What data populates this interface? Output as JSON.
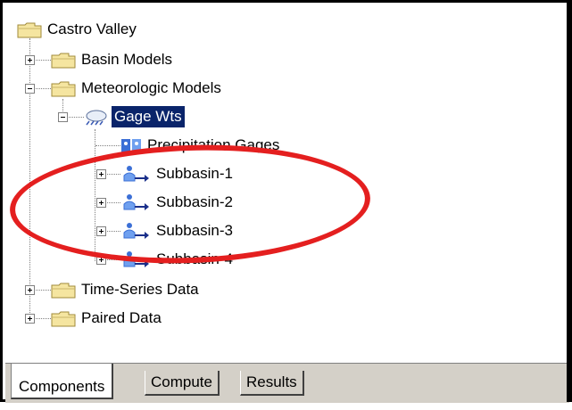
{
  "tree": {
    "root": "Castro Valley",
    "basin_models": "Basin Models",
    "meteorologic_models": "Meteorologic Models",
    "gage_wts": "Gage Wts",
    "precipitation_gages": "Precipitation Gages",
    "subbasins": [
      "Subbasin-1",
      "Subbasin-2",
      "Subbasin-3",
      "Subbasin-4"
    ],
    "time_series_data": "Time-Series Data",
    "paired_data": "Paired Data"
  },
  "tabs": {
    "components": "Components",
    "compute": "Compute",
    "results": "Results"
  },
  "icons": {
    "folder": "folder-icon",
    "meteorologic": "meteorologic-model-icon",
    "gage": "precipitation-gage-icon",
    "subbasin": "subbasin-icon"
  },
  "colors": {
    "selection": "#0a246a",
    "annotation_oval": "#e41f1f",
    "folder": "#f5e5a0"
  }
}
